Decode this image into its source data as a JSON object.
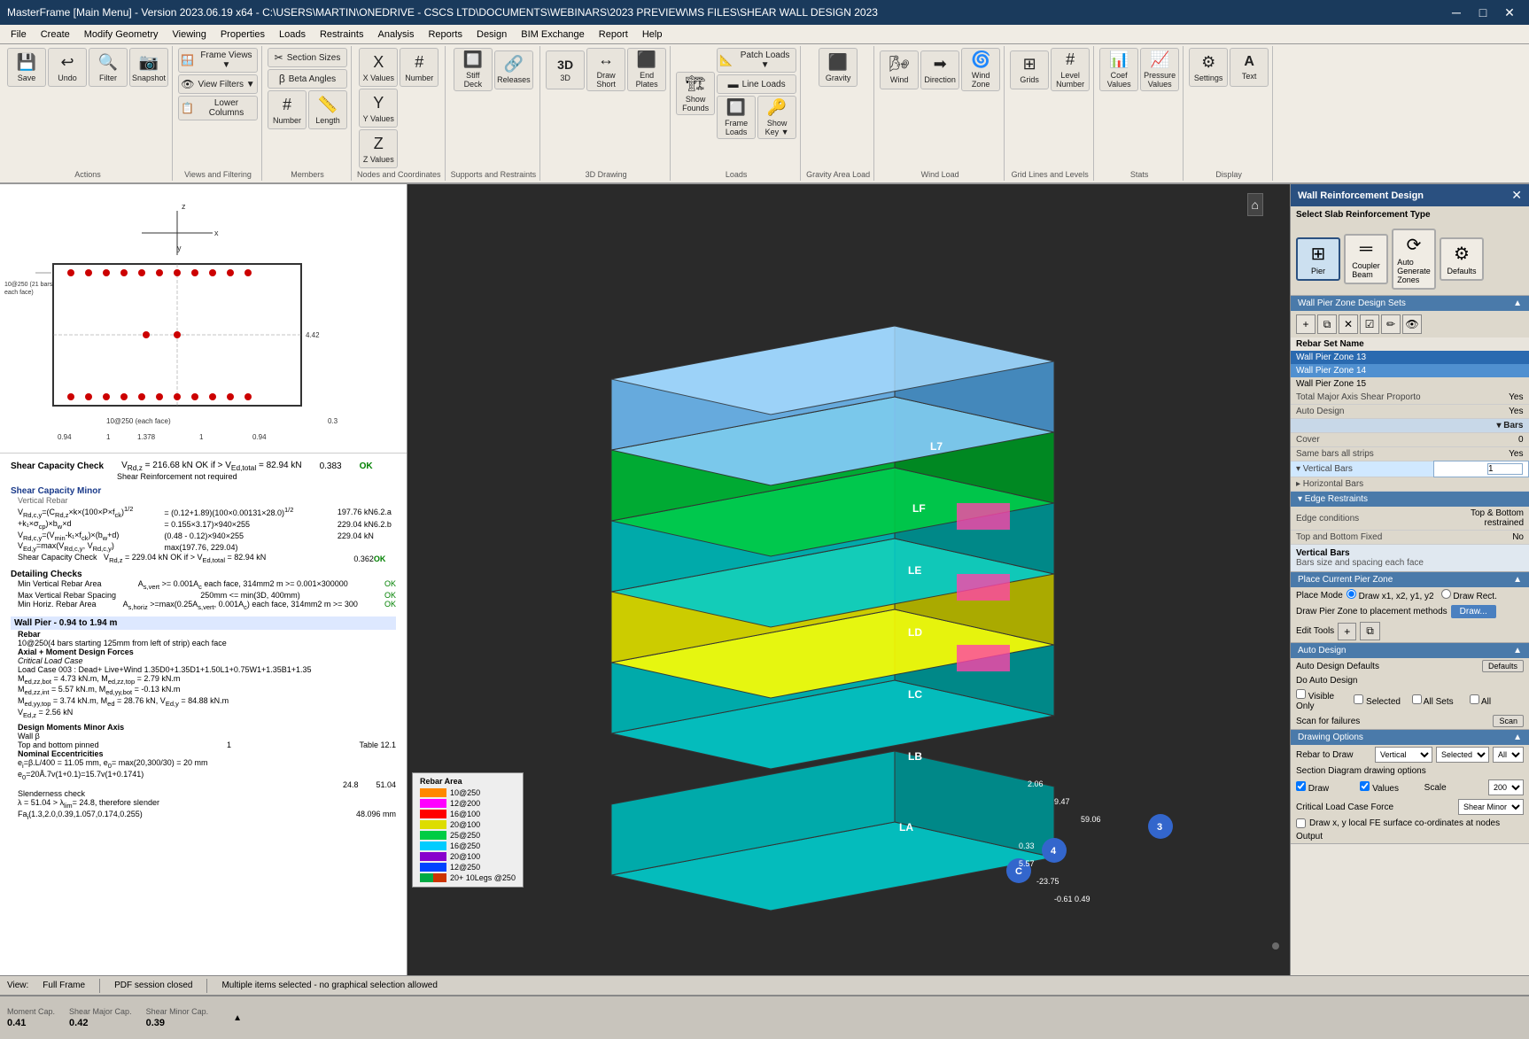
{
  "titlebar": {
    "title": "MasterFrame [Main Menu] - Version 2023.06.19 x64 - C:\\USERS\\MARTIN\\ONEDRIVE - CSCS LTD\\DOCUMENTS\\WEBINARS\\2023 PREVIEW\\MS FILES\\SHEAR WALL DESIGN 2023",
    "min": "─",
    "max": "□",
    "close": "✕"
  },
  "menubar": {
    "items": [
      "File",
      "Create",
      "Modify Geometry",
      "Viewing",
      "Properties",
      "Loads",
      "Restraints",
      "Analysis",
      "Reports",
      "Design",
      "BIM Exchange",
      "Report",
      "Help"
    ]
  },
  "toolbar": {
    "groups": [
      {
        "label": "Actions",
        "buttons": [
          {
            "icon": "💾",
            "label": "Save"
          },
          {
            "icon": "↩",
            "label": "Undo"
          },
          {
            "icon": "🔍",
            "label": "Filter"
          },
          {
            "icon": "📷",
            "label": "Snapshot"
          }
        ]
      },
      {
        "label": "Views and Filtering",
        "buttons": [
          {
            "icon": "🪟",
            "label": "Frame Views"
          },
          {
            "icon": "👁",
            "label": "View Filters"
          },
          {
            "icon": "📋",
            "label": "Lower Columns"
          }
        ]
      },
      {
        "label": "Members",
        "buttons": [
          {
            "icon": "✂",
            "label": "Section Sizes"
          },
          {
            "icon": "β",
            "label": "Beta Angles"
          },
          {
            "icon": "#",
            "label": "Number"
          },
          {
            "icon": "📏",
            "label": "Length"
          }
        ]
      },
      {
        "label": "Nodes and Coordinates",
        "buttons": [
          {
            "icon": "X",
            "label": "X Values"
          },
          {
            "icon": "Y",
            "label": "Y Values"
          },
          {
            "icon": "Z",
            "label": "Z Values"
          },
          {
            "icon": "#",
            "label": "Number"
          }
        ]
      },
      {
        "label": "Supports and Restraints",
        "buttons": [
          {
            "icon": "🔲",
            "label": "Stiff Deck"
          },
          {
            "icon": "🔗",
            "label": "Releases"
          }
        ]
      },
      {
        "label": "3D Drawing",
        "buttons": [
          {
            "icon": "3D",
            "label": "3D"
          },
          {
            "icon": "↔",
            "label": "Draw Short"
          },
          {
            "icon": "⬛",
            "label": "End Plates"
          }
        ]
      },
      {
        "label": "Loads",
        "buttons": [
          {
            "icon": "🏗",
            "label": "Show Founds"
          },
          {
            "icon": "📐",
            "label": "Patch Loads"
          },
          {
            "icon": "▬",
            "label": "Line Loads"
          },
          {
            "icon": "🔲",
            "label": "Frame Loads"
          },
          {
            "icon": "👁",
            "label": "Show Key"
          }
        ]
      },
      {
        "label": "Gravity Area Load",
        "buttons": [
          {
            "icon": "⬛",
            "label": "Gravity"
          }
        ]
      },
      {
        "label": "Wind Load",
        "buttons": [
          {
            "icon": "🌬",
            "label": "Wind"
          },
          {
            "icon": "➡",
            "label": "Direction"
          },
          {
            "icon": "🌀",
            "label": "Wind Zone"
          }
        ]
      },
      {
        "label": "Grid Lines and Levels",
        "buttons": [
          {
            "icon": "⊞",
            "label": "Grids"
          },
          {
            "icon": "#",
            "label": "Level Number"
          }
        ]
      },
      {
        "label": "Stats",
        "buttons": [
          {
            "icon": "📊",
            "label": "Coef Values"
          },
          {
            "icon": "📈",
            "label": "Pressure Values"
          }
        ]
      },
      {
        "label": "Display",
        "buttons": [
          {
            "icon": "⚙",
            "label": "Settings"
          },
          {
            "icon": "A",
            "label": "Text"
          }
        ]
      }
    ]
  },
  "right_panel": {
    "title": "Wall Reinforcement Design",
    "close_btn": "✕",
    "select_slab_section": "Select Slab Reinforcement Type",
    "srt_types": [
      {
        "label": "Pier",
        "icon": "⊞",
        "active": true
      },
      {
        "label": "Coupler\nBeam",
        "icon": "═"
      },
      {
        "label": "Auto\nGenerate\nZones",
        "icon": "⟳"
      },
      {
        "label": "Defaults",
        "icon": "⚙"
      }
    ],
    "wall_pier_section": "Wall Pier Zone Design Sets",
    "rebar_toolbar_btns": [
      "+",
      "⧉",
      "✕",
      "☑",
      "✏",
      "👁"
    ],
    "rebar_set_name_label": "Rebar Set Name",
    "rebar_list": [
      {
        "label": "Wall Pier Zone 13",
        "selected": true
      },
      {
        "label": "Wall Pier Zone 14",
        "selected": true
      },
      {
        "label": "Wall Pier Zone 15",
        "selected": false
      }
    ],
    "properties": [
      {
        "label": "Total Major Axis Shear Proporto",
        "value": "Yes"
      },
      {
        "label": "Auto Design",
        "value": "Yes"
      },
      {
        "label": "Bars",
        "type": "subheader"
      },
      {
        "label": "Cover",
        "value": "0"
      },
      {
        "label": "Same bars all strips",
        "value": "Yes"
      },
      {
        "label": "Vertical Bars",
        "value": "1",
        "editable": true,
        "highlighted": true
      },
      {
        "label": "Horizontal Bars",
        "value": ""
      }
    ],
    "edge_restraints": {
      "label": "Edge Restraints",
      "conditions_label": "Edge conditions",
      "conditions_value": "Top & Bottom restrained",
      "second_label": "Top and Bottom Fixed",
      "second_value": "No"
    },
    "vertical_bars_section": {
      "title": "Vertical Bars",
      "subtitle": "Bars size and spacing each face"
    },
    "place_pier_zone": {
      "title": "Place Current Pier Zone",
      "place_mode_label": "Place Mode",
      "mode1": "Draw x1, x2, y1, y2",
      "mode2": "Draw Rect.",
      "draw_pier_zone_label": "Draw Pier Zone to placement methods",
      "draw_btn": "Draw...",
      "edit_tools_label": "Edit Tools"
    },
    "auto_design": {
      "title": "Auto Design",
      "defaults_label": "Auto Design Defaults",
      "defaults_btn": "Defaults",
      "do_auto_design_label": "Do Auto Design",
      "options": [
        "Visible Only",
        "Selected",
        "All Sets",
        "All"
      ],
      "scan_label": "Scan for failures",
      "scan_btn": "Scan"
    },
    "drawing_options": {
      "title": "Drawing Options",
      "rebar_to_draw_label": "Rebar to Draw",
      "rebar_to_draw_value": "Vertical",
      "section_diagram_label": "Section Diagram drawing options",
      "draw_checkbox": true,
      "values_checkbox": true,
      "scale_label": "Scale",
      "scale_value": "200",
      "critical_load_label": "Critical Load Case Force",
      "critical_load_value": "Shear Minor",
      "draw_xy_label": "Draw x, y local FE surface co-ordinates at nodes",
      "output_label": "Output"
    }
  },
  "left_panel": {
    "dimensions": {
      "top_label": "10@250 (21 bars each face)",
      "dim1": "10@250 (each face)",
      "dim2": "4.42",
      "dim3": "0.3",
      "dim_values": [
        "0.94",
        "1",
        "1.378",
        "1",
        "0.94"
      ]
    },
    "shear_capacity": {
      "title": "Shear Capacity Check",
      "vrd": "Vrd,z = 216.68 kN OK if > VEd,total = 82.94 kN",
      "ratio": "0.383",
      "status": "OK",
      "shear_reinf": "Shear Reinforcement not required"
    },
    "shear_capacity_minor": {
      "title": "Shear Capacity Minor",
      "title2": "Vertical Rebar",
      "row1a": "Vrd,c,y=(CRd,z×k×(100×P×fck)^1/2",
      "row1b": "= (0.12+1.89)(100×0.00131×28.0)^1/2",
      "row2a": "+k1×σcp)×bw×d",
      "row2b": "= 0.155×3.17)×940×255",
      "row3a": "VRd,c,y=(Vmin-k1×fck)×(bw+d)",
      "row3b": "(0.48 - 0.12)×940×255",
      "row4a": "VEd,y=max(VRd,c,y, VRd,c,y)",
      "row4b": "max(197.76, 229.04)",
      "row5a": "Shear Capacity Check",
      "row5b": "VRd,z = 229.04 kN OK if > VEd,total = 82.94 kN",
      "values1": [
        "197.76 kN",
        "6.2.a"
      ],
      "values2": [
        "229.04 kN",
        "6.2.b"
      ],
      "values3": [
        "229.04 kN",
        ""
      ],
      "ratio2": "0.362",
      "status2": "OK"
    },
    "detailing_checks": {
      "title": "Detailing Checks",
      "min_vert": "Min Vertical Rebar Area",
      "min_vert_val": "As,vert >= 0.001Ac each face, 314mm2 m >= 0.001×300000",
      "min_vert_status": "OK",
      "max_vert": "Max Vertical Rebar Spacing",
      "max_vert_val": "250mm <= min(3D, 400mm)",
      "max_vert_status": "OK",
      "min_horiz": "Min Horiz. Rebar Area",
      "min_horiz_val": "As,horiz >=max(0.25As,vert, 0.001Ac) each face, 314mm2 m >= 300",
      "min_horiz_status": "OK"
    },
    "wall_pier": {
      "title": "Wall Pier - 0.94 to 1.94 m",
      "rebar": "Rebar",
      "rebar_val": "10@250(4 bars starting 125mm from left of strip) each face",
      "axial_moment": "Axial + Moment Design Forces",
      "crit_load": "Critical Load Case",
      "load_case": "Load Case 003 : Dead+ Live+Wind 1.35D0+1.35D1+1.50L1+0.75W1+1.35B1+1.35",
      "mzz_bot": "Med,zz,bot = 4.73 kN.m, Med,zz,top = 2.79 kN.m",
      "mzz_int": "Med,zz,int = 5.57 kN.m, Med,yy,bot = -0.13 kN.m",
      "ved": "Med,yy,top = 3.74 kN.m, Med = 28.76 kN, VEd,y = 84.88 kN.m",
      "vrd": "VEd,z = 2.56 kN"
    },
    "design_moments": {
      "title": "Design Moments Minor Axis",
      "wall_beta": "Wall β",
      "top_bottom": "Top and bottom pinned",
      "tb_val": "1",
      "table_ref": "Table 12.1",
      "nom_ecc": "Nominal Eccentricities",
      "ecc_vals": "ei=β.L/400 = 11.05 mm, e0= max(20,300/30) = 20 mm",
      "ecc_vals2": "e0=20A.7v(1+0.1)=15.7v(1+0.1741)",
      "values": [
        "24.8",
        "51.04"
      ],
      "slender_label": "Slenderness check",
      "slender_val": "λ = 51.04 > λlim= 24.8, therefore slender",
      "fai_val": "Fai(1.3,2.0,0.39,1.057,0.174,0.255)",
      "fai_num": "48.096 mm"
    },
    "bottom_bar": {
      "moment_cap": "Moment Cap.",
      "shear_major": "Shear Major Cap.",
      "shear_minor": "Shear Minor Cap.",
      "moment_val": "0.41",
      "shear_major_val": "0.42",
      "shear_minor_val": "0.39"
    }
  },
  "legend": {
    "title": "Rebar Area",
    "items": [
      {
        "color": "#ff8800",
        "label": "10@250"
      },
      {
        "color": "#ff00ff",
        "label": "12@200"
      },
      {
        "color": "#ff0000",
        "label": "16@100"
      },
      {
        "color": "#ffff00",
        "label": "20@100"
      },
      {
        "color": "#00ff00",
        "label": "25@250"
      },
      {
        "color": "#00ffff",
        "label": "16@250"
      },
      {
        "color": "#8800ff",
        "label": "20@100"
      },
      {
        "color": "#0000ff",
        "label": "12@250"
      },
      {
        "color": "#00aa00",
        "label": "20+ 10Legs @250"
      }
    ]
  },
  "statusbar": {
    "view_label": "View:",
    "view_value": "Full Frame",
    "pdf_status": "PDF session closed",
    "selection_status": "Multiple items selected - no graphical selection allowed"
  }
}
